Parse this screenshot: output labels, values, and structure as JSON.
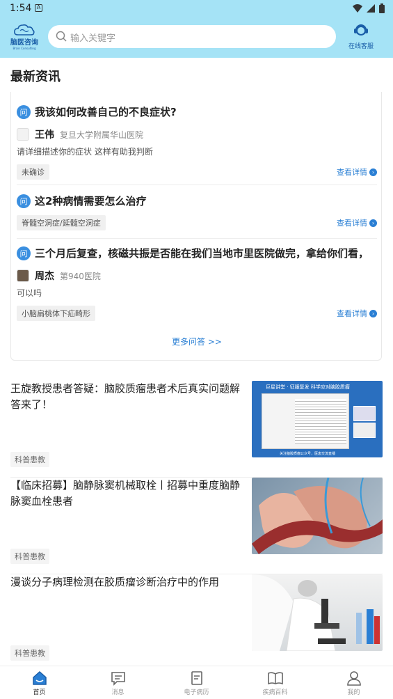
{
  "status_bar": {
    "time": "1:54",
    "notif_icon": "A"
  },
  "header": {
    "logo_text": "脑医咨询",
    "logo_sub": "Brain Consulting",
    "search_placeholder": "输入关键字",
    "service_label": "在线客服"
  },
  "section": {
    "title": "最新资讯"
  },
  "qa": {
    "items": [
      {
        "badge": "问",
        "question": "我该如何改善自己的不良症状?",
        "doctor_name": "王伟",
        "hospital": "复旦大学附属华山医院",
        "answer": "请详细描述你的症状 这样有助我判断",
        "tag": "未确诊",
        "detail": "查看详情"
      },
      {
        "badge": "问",
        "question": "这2种病情需要怎么治疗",
        "tag": "脊髓空洞症/延髓空洞症",
        "detail": "查看详情"
      },
      {
        "badge": "问",
        "question": "三个月后复查，核磁共振是否能在我们当地市里医院做完，拿给你们看，",
        "doctor_name": "周杰",
        "hospital": "第940医院",
        "answer": "可以吗",
        "tag": "小脑扁桃体下疝畸形",
        "detail": "查看详情"
      }
    ],
    "more": "更多问答 >>"
  },
  "articles": [
    {
      "title": "王旋教授患者答疑：脑胶质瘤患者术后真实问题解答来了！",
      "category": "科普患教",
      "thumb_banner": "巨星讲堂 · 征服复发 科学应对脑胶质瘤",
      "thumb_footer": "关注脑胶质瘤公众号，医患交流直播"
    },
    {
      "title": "【临床招募】脑静脉窦机械取栓丨招募中重度脑静脉窦血栓患者",
      "category": "科普患教"
    },
    {
      "title": "漫谈分子病理检测在胶质瘤诊断治疗中的作用",
      "category": "科普患教"
    }
  ],
  "tabs": [
    {
      "label": "首页",
      "icon": "home-icon"
    },
    {
      "label": "消息",
      "icon": "message-icon"
    },
    {
      "label": "电子病历",
      "icon": "document-icon"
    },
    {
      "label": "疾病百科",
      "icon": "book-icon"
    },
    {
      "label": "我的",
      "icon": "user-icon"
    }
  ],
  "colors": {
    "header_bg": "#a5e3f6",
    "accent": "#2a7fd4",
    "logo": "#1a5ea8"
  }
}
